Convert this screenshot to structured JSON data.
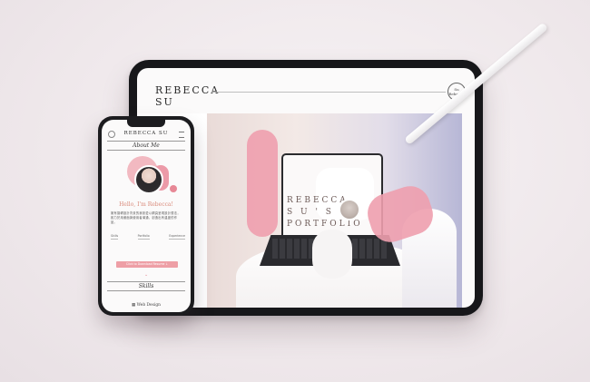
{
  "tablet": {
    "title": "REBECCA\nSU",
    "logo_text": "Su\nRebecca",
    "hero_portfolio": "REBECCA\nS U ' S\nPORTFOLIO"
  },
  "phone": {
    "title": "REBECCA SU",
    "about_heading": "About Me",
    "greeting": "Hello, I'm Rebecca!",
    "bio": "擁有攝轉設計背景的我熱愛以網頁呈現設計想法，致力於用畫面與使用者溝通，創造出有溫度的作品。",
    "links": [
      "Skills",
      "Portfolio",
      "Experience"
    ],
    "download_button": "Click to Download Resume ↓",
    "skills_heading": "Skills",
    "skill_item": "Web Design"
  }
}
